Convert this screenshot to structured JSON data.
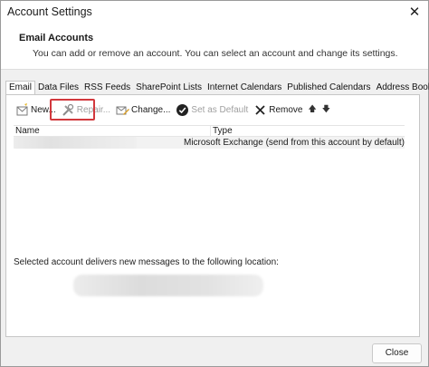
{
  "window": {
    "title": "Account Settings"
  },
  "header": {
    "title": "Email Accounts",
    "description": "You can add or remove an account. You can select an account and change its settings."
  },
  "tabs": [
    {
      "label": "Email",
      "active": true
    },
    {
      "label": "Data Files"
    },
    {
      "label": "RSS Feeds"
    },
    {
      "label": "SharePoint Lists"
    },
    {
      "label": "Internet Calendars"
    },
    {
      "label": "Published Calendars"
    },
    {
      "label": "Address Books"
    }
  ],
  "toolbar": {
    "new_label": "New...",
    "repair_label": "Repair...",
    "change_label": "Change...",
    "default_label": "Set as Default",
    "remove_label": "Remove",
    "up_arrow": "🡅",
    "down_arrow": "🡇",
    "highlight_color": "#d2383d"
  },
  "accounts": {
    "columns": [
      "Name",
      "Type"
    ],
    "rows": [
      {
        "type": "Microsoft Exchange (send from this account by default)"
      }
    ]
  },
  "delivery": {
    "label": "Selected account delivers new messages to the following location:"
  },
  "footer": {
    "close_label": "Close"
  }
}
